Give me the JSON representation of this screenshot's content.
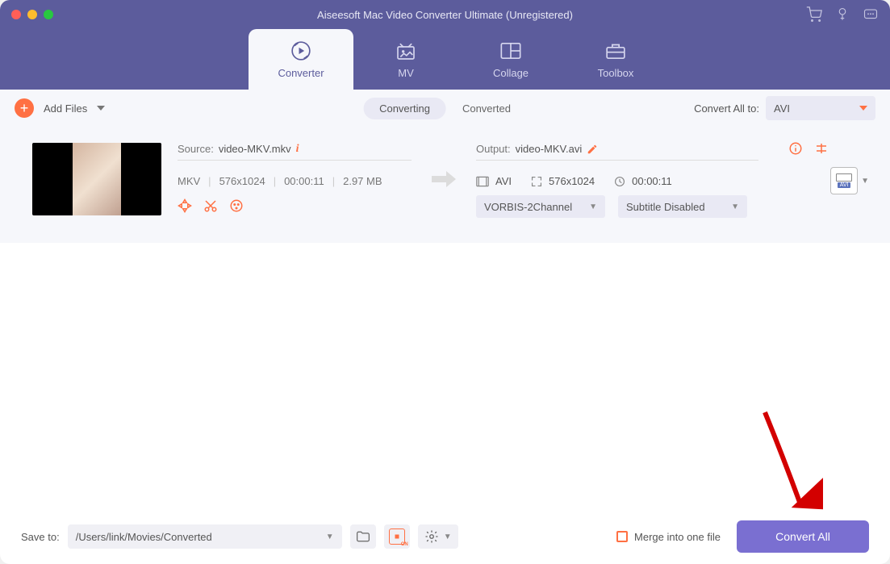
{
  "window": {
    "title": "Aiseesoft Mac Video Converter Ultimate (Unregistered)"
  },
  "nav": {
    "tabs": [
      {
        "label": "Converter"
      },
      {
        "label": "MV"
      },
      {
        "label": "Collage"
      },
      {
        "label": "Toolbox"
      }
    ]
  },
  "subbar": {
    "add_label": "Add Files",
    "segments": [
      {
        "label": "Converting"
      },
      {
        "label": "Converted"
      }
    ],
    "convert_all_label": "Convert All to:",
    "convert_all_value": "AVI"
  },
  "file": {
    "source": {
      "label": "Source:",
      "name": "video-MKV.mkv",
      "format": "MKV",
      "resolution": "576x1024",
      "duration": "00:00:11",
      "size": "2.97 MB"
    },
    "output": {
      "label": "Output:",
      "name": "video-MKV.avi",
      "format": "AVI",
      "resolution": "576x1024",
      "duration": "00:00:11",
      "audio": "VORBIS-2Channel",
      "subtitle": "Subtitle Disabled",
      "badge": "AVI"
    }
  },
  "footer": {
    "save_label": "Save to:",
    "path": "/Users/link/Movies/Converted",
    "merge_label": "Merge into one file",
    "convert_button": "Convert All"
  }
}
